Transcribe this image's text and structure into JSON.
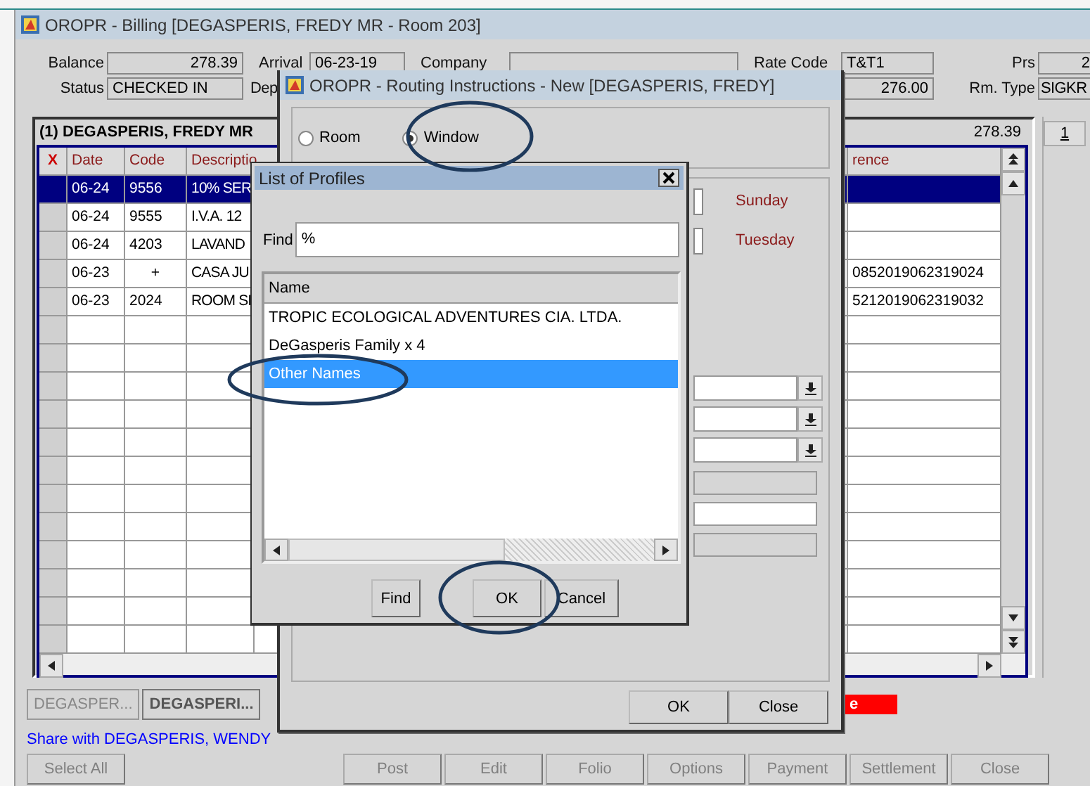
{
  "billing_window": {
    "title": "OROPR - Billing [DEGASPERIS, FREDY MR - Room 203]"
  },
  "header": {
    "balance": {
      "label": "Balance",
      "value": "278.39"
    },
    "arrival": {
      "label": "Arrival",
      "value": "06-23-19"
    },
    "company": {
      "label": "Company"
    },
    "rate_code": {
      "label": "Rate Code",
      "value": "T&T1"
    },
    "persons": {
      "label": "Prs",
      "value": "2"
    },
    "status": {
      "label": "Status",
      "value": "CHECKED IN"
    },
    "departure": {
      "label": "Dep"
    },
    "rate": {
      "value": "276.00"
    },
    "room_type": {
      "label": "Rm. Type",
      "value": "SIGKR"
    }
  },
  "folio": {
    "title": "(1) DEGASPERIS, FREDY MR",
    "total": "278.39",
    "columns": [
      "X",
      "Date",
      "Code",
      "Descriptio",
      "rence"
    ],
    "rows": [
      {
        "date": "06-24",
        "code": "9556",
        "description": "10% SER",
        "selected": true
      },
      {
        "date": "06-24",
        "code": "9555",
        "description": "I.V.A. 12",
        "selected": false
      },
      {
        "date": "06-24",
        "code": "4203",
        "description": "LAVAND",
        "selected": false
      },
      {
        "date": "06-23",
        "code": "+",
        "description": "CASA JU",
        "reference": "0852019062319024",
        "selected": false
      },
      {
        "date": "06-23",
        "code": "2024",
        "description": "ROOM SI",
        "reference": "5212019062319032",
        "selected": false
      }
    ]
  },
  "window_tab": "1",
  "folio_tabs": [
    {
      "label": "DEGASPER...",
      "selected": false
    },
    {
      "label": "DEGASPERI...",
      "selected": true
    }
  ],
  "share_text": "Share with DEGASPERIS, WENDY",
  "alert_text": "e",
  "actions": [
    {
      "label": "Select All",
      "disabled": true
    },
    {
      "label": "Post",
      "disabled": true
    },
    {
      "label": "Edit",
      "disabled": true
    },
    {
      "label": "Folio",
      "disabled": true
    },
    {
      "label": "Options",
      "disabled": true
    },
    {
      "label": "Payment",
      "disabled": true
    },
    {
      "label": "Settlement",
      "disabled": true
    },
    {
      "label": "Close",
      "disabled": true
    }
  ],
  "routing_dialog": {
    "title": "OROPR - Routing Instructions - New [DEGASPERIS, FREDY]",
    "route_to": [
      {
        "label": "Room",
        "selected": false
      },
      {
        "label": "Window",
        "selected": true
      }
    ],
    "days": [
      "Sunday",
      "Tuesday"
    ],
    "dropdowns": [
      {
        "disabled": false
      },
      {
        "disabled": false
      },
      {
        "disabled": false
      }
    ],
    "fields": [
      {
        "disabled": true
      },
      {
        "disabled": false
      },
      {
        "disabled": true
      }
    ],
    "buttons": [
      "OK",
      "Close"
    ]
  },
  "profiles_dialog": {
    "title": "List of Profiles",
    "find_label": "Find",
    "find_value": "%",
    "column": "Name",
    "rows": [
      {
        "name": "TROPIC ECOLOGICAL ADVENTURES CIA. LTDA.",
        "selected": false
      },
      {
        "name": "DeGasperis Family x 4",
        "selected": false
      },
      {
        "name": "Other Names",
        "selected": true
      }
    ],
    "buttons": [
      "Find",
      "OK",
      "Cancel"
    ]
  }
}
